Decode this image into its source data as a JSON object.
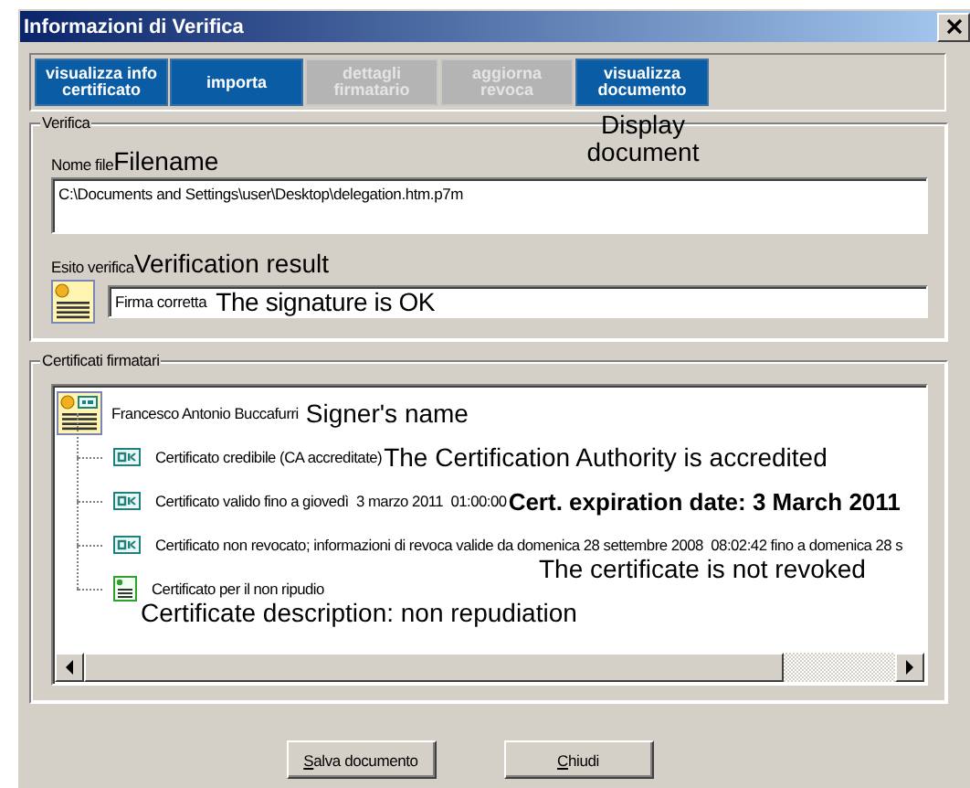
{
  "window": {
    "title": "Informazioni di Verifica"
  },
  "tabs": [
    {
      "label": "visualizza info certificato",
      "disabled": false
    },
    {
      "label": "importa",
      "disabled": false
    },
    {
      "label": "dettagli firmatario",
      "disabled": true
    },
    {
      "label": "aggiorna revoca",
      "disabled": true
    },
    {
      "label": "visualizza documento",
      "disabled": false,
      "note": "Display document"
    }
  ],
  "verifica": {
    "title": "Verifica",
    "file_label": "Nome file",
    "file_note": "Filename",
    "file_value": "C:\\Documents and Settings\\user\\Desktop\\delegation.htm.p7m",
    "result_label": "Esito verifica",
    "result_note": "Verification result",
    "result_value": "Firma corretta",
    "result_value_note": "The signature is OK"
  },
  "certificati": {
    "title": "Certificati firmatari",
    "signer": {
      "name": "Francesco Antonio Buccafurri",
      "note": "Signer's name",
      "children": [
        {
          "kind": "ok",
          "text": "Certificato credibile (CA accreditate)",
          "note": {
            "kind": "inline",
            "text": "The Certification Authority is accredited"
          }
        },
        {
          "kind": "ok",
          "text": "Certificato valido fino a giovedì  3 marzo 2011  01:00:00",
          "note": {
            "kind": "bold",
            "text": "Cert. expiration date: 3 March 2011"
          }
        },
        {
          "kind": "ok",
          "text": "Certificato non revocato; informazioni di revoca valide da domenica 28 settembre 2008  08:02:42 fino a domenica 28 s",
          "note": {
            "kind": "below_right",
            "text": "The certificate is not revoked"
          }
        },
        {
          "kind": "doc",
          "text": "Certificato per il non ripudio",
          "note": {
            "kind": "below",
            "text": "Certificate description: non repudiation"
          }
        }
      ]
    }
  },
  "buttons": [
    {
      "label": "Salva documento"
    },
    {
      "label": "Chiudi"
    }
  ]
}
